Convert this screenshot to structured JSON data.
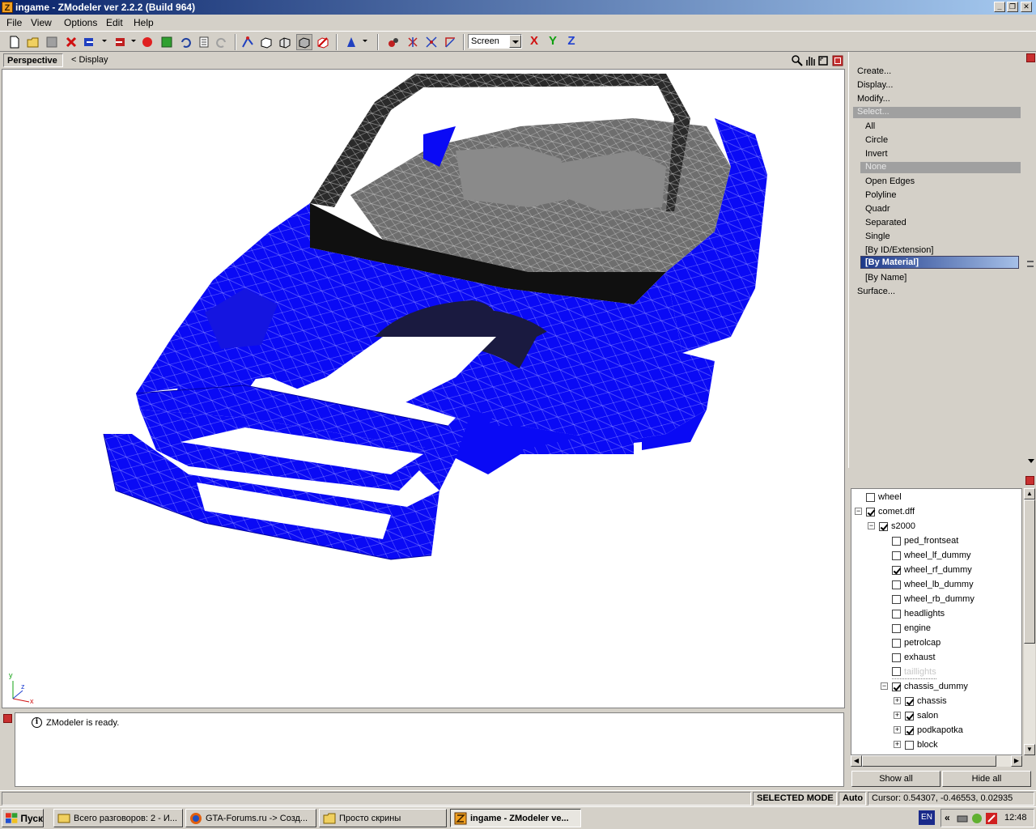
{
  "window": {
    "title": "ingame - ZModeler ver 2.2.2 (Build 964)",
    "app_icon_letter": "Z",
    "minimize": "_",
    "restore": "❐",
    "close": "✕"
  },
  "menu": [
    "File",
    "View",
    "Options",
    "Edit",
    "Help"
  ],
  "toolbar": {
    "view_mode": "Screen",
    "axis_x": "X",
    "axis_y": "Y",
    "axis_z": "Z"
  },
  "viewport": {
    "tab": "Perspective",
    "breadcrumb": "<  Display",
    "gizmo": {
      "y": "y",
      "z": "z",
      "x": "x"
    }
  },
  "commands": {
    "create": "Create...",
    "display": "Display...",
    "modify": "Modify...",
    "select": "Select...",
    "select_items": [
      "All",
      "Circle",
      "Invert",
      "None",
      "Open Edges",
      "Polyline",
      "Quadr",
      "Separated",
      "Single",
      "[By ID/Extension]",
      "[By Material]",
      "[By Name]"
    ],
    "surface": "Surface..."
  },
  "tree": [
    {
      "label": "wheel",
      "checked": false,
      "level": 0,
      "expander": ""
    },
    {
      "label": "comet.dff",
      "checked": true,
      "level": 0,
      "expander": "−"
    },
    {
      "label": "s2000",
      "checked": true,
      "level": 1,
      "expander": "−"
    },
    {
      "label": "ped_frontseat",
      "checked": false,
      "level": 2,
      "expander": ""
    },
    {
      "label": "wheel_lf_dummy",
      "checked": false,
      "level": 2,
      "expander": ""
    },
    {
      "label": "wheel_rf_dummy",
      "checked": true,
      "level": 2,
      "expander": ""
    },
    {
      "label": "wheel_lb_dummy",
      "checked": false,
      "level": 2,
      "expander": ""
    },
    {
      "label": "wheel_rb_dummy",
      "checked": false,
      "level": 2,
      "expander": ""
    },
    {
      "label": "headlights",
      "checked": false,
      "level": 2,
      "expander": ""
    },
    {
      "label": "engine",
      "checked": false,
      "level": 2,
      "expander": ""
    },
    {
      "label": "petrolcap",
      "checked": false,
      "level": 2,
      "expander": ""
    },
    {
      "label": "exhaust",
      "checked": false,
      "level": 2,
      "expander": ""
    },
    {
      "label": "taillights",
      "checked": false,
      "level": 2,
      "expander": "",
      "dim": true
    },
    {
      "label": "chassis_dummy",
      "checked": true,
      "level": 2,
      "expander": "−"
    },
    {
      "label": "chassis",
      "checked": true,
      "level": 3,
      "expander": "+"
    },
    {
      "label": "salon",
      "checked": true,
      "level": 3,
      "expander": "+"
    },
    {
      "label": "podkapotka",
      "checked": true,
      "level": 3,
      "expander": "+"
    },
    {
      "label": "block",
      "checked": false,
      "level": 3,
      "expander": "+"
    }
  ],
  "tree_buttons": {
    "show_all": "Show all",
    "hide_all": "Hide all"
  },
  "log": {
    "message": "ZModeler is ready.",
    "icon": "i"
  },
  "status": {
    "mode": "SELECTED MODE",
    "auto": "Auto",
    "cursor": "Cursor: 0.54307, -0.46553, 0.02935"
  },
  "taskbar": {
    "start": "Пуск",
    "tasks": [
      {
        "label": "Всего разговоров: 2 - И...",
        "active": false
      },
      {
        "label": "GTA-Forums.ru -> Созд...",
        "active": false
      },
      {
        "label": "Просто скрины",
        "active": false
      },
      {
        "label": "ingame - ZModeler ve...",
        "active": true
      }
    ],
    "lang": "EN",
    "tray_chevron": "«",
    "clock": "12:48"
  },
  "colors": {
    "body_paint": "#0a0af5",
    "interior": "#707070",
    "title_start": "#0a246a",
    "title_end": "#a6caf0"
  }
}
